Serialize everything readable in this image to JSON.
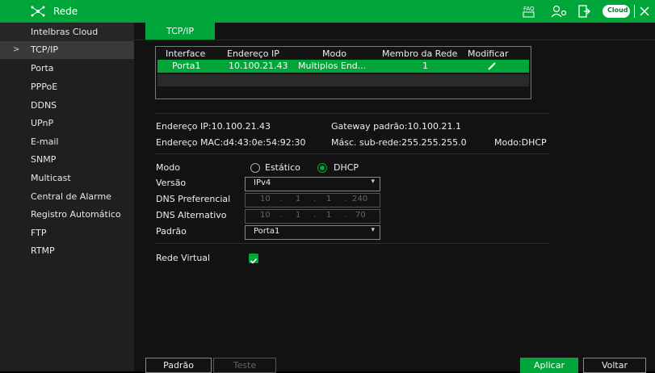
{
  "window": {
    "title": "Rede"
  },
  "toolbar_icons": [
    "faq-icon",
    "users-icon",
    "logout-icon",
    "intelbras-cloud-icon",
    "close-icon"
  ],
  "toolbar": {
    "cloud_label": "Cloud"
  },
  "sidebar": {
    "items": [
      {
        "label": "Intelbras Cloud"
      },
      {
        "label": "TCP/IP",
        "marker": ">"
      },
      {
        "label": "Porta"
      },
      {
        "label": "PPPoE"
      },
      {
        "label": "DDNS"
      },
      {
        "label": "UPnP"
      },
      {
        "label": "E-mail"
      },
      {
        "label": "SNMP"
      },
      {
        "label": "Multicast"
      },
      {
        "label": "Central de Alarme"
      },
      {
        "label": "Registro Automático"
      },
      {
        "label": "FTP"
      },
      {
        "label": "RTMP"
      }
    ]
  },
  "tab": {
    "label": "TCP/IP"
  },
  "table": {
    "headers": [
      "Interface",
      "Endereço IP",
      "Modo",
      "Membro da Rede",
      "Modificar"
    ],
    "rows": [
      {
        "interface": "Porta1",
        "ip": "10.100.21.43",
        "mode": "Multiplos End...",
        "member": "1"
      }
    ]
  },
  "info": {
    "ip": "Endereço IP:10.100.21.43",
    "gateway": "Gateway padrão:10.100.21.1",
    "mac": "Endereço MAC:d4:43:0e:54:92:30",
    "mask": "Másc. sub-rede:255.255.255.0",
    "mode": "Modo:DHCP"
  },
  "form": {
    "mode_label": "Modo",
    "static_label": "Estático",
    "dhcp_label": "DHCP",
    "selected_mode": "DHCP",
    "version_label": "Versão",
    "version_value": "IPv4",
    "dns1_label": "DNS Preferencial",
    "dns1": [
      "10",
      "1",
      "1",
      "240"
    ],
    "dns2_label": "DNS Alternativo",
    "dns2": [
      "10",
      "1",
      "1",
      "70"
    ],
    "default_label": "Padrão",
    "default_value": "Porta1",
    "virtual_label": "Rede Virtual",
    "virtual_checked": true
  },
  "buttons": {
    "default": "Padrão",
    "test": "Teste",
    "apply": "Aplicar",
    "back": "Voltar"
  },
  "colors": {
    "accent": "#00a63a"
  }
}
